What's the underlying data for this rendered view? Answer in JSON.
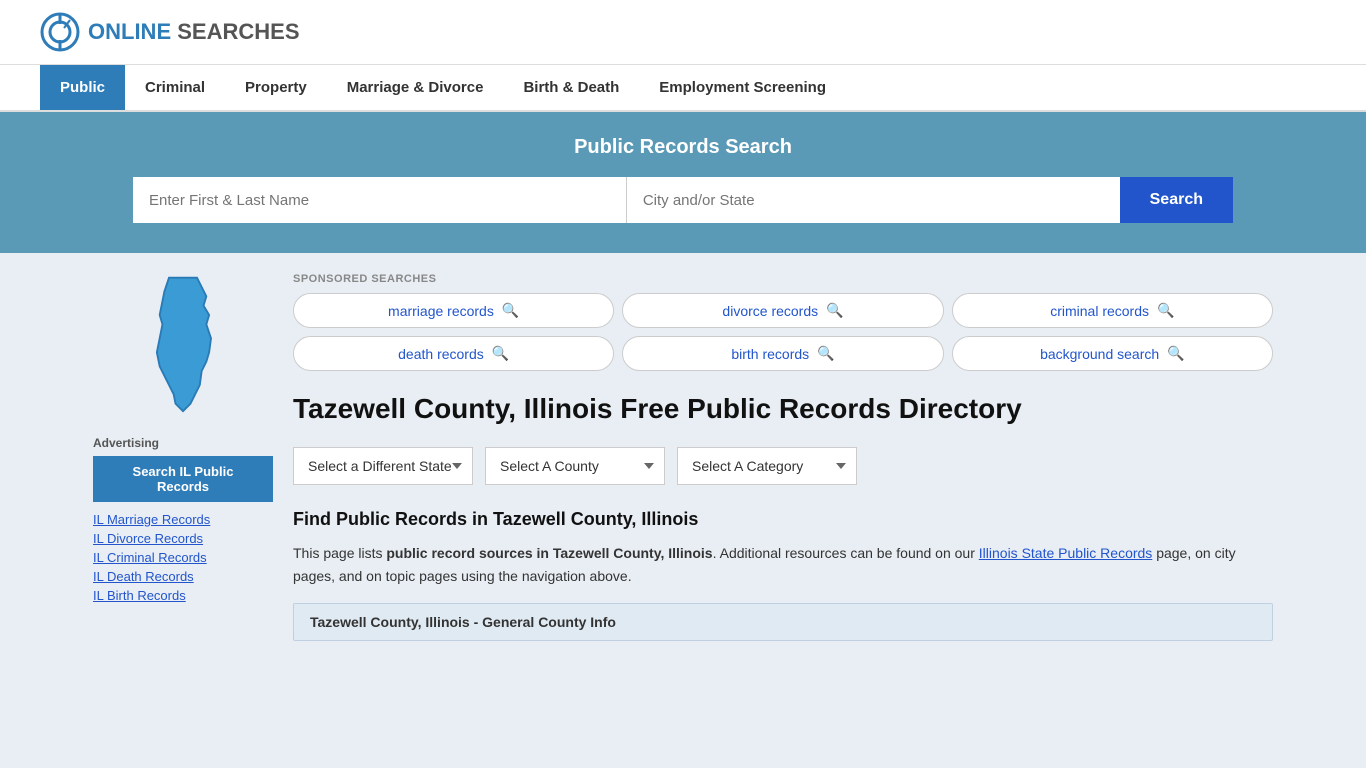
{
  "header": {
    "logo_text_normal": "ONLINE",
    "logo_text_bold": "SEARCHES"
  },
  "nav": {
    "items": [
      {
        "label": "Public",
        "active": true
      },
      {
        "label": "Criminal",
        "active": false
      },
      {
        "label": "Property",
        "active": false
      },
      {
        "label": "Marriage & Divorce",
        "active": false
      },
      {
        "label": "Birth & Death",
        "active": false
      },
      {
        "label": "Employment Screening",
        "active": false
      }
    ]
  },
  "search_banner": {
    "title": "Public Records Search",
    "name_placeholder": "Enter First & Last Name",
    "location_placeholder": "City and/or State",
    "button_label": "Search"
  },
  "sponsored": {
    "label": "SPONSORED SEARCHES",
    "items": [
      {
        "text": "marriage records"
      },
      {
        "text": "divorce records"
      },
      {
        "text": "criminal records"
      },
      {
        "text": "death records"
      },
      {
        "text": "birth records"
      },
      {
        "text": "background search"
      }
    ]
  },
  "page": {
    "title": "Tazewell County, Illinois Free Public Records Directory",
    "state_label": "Illinois",
    "dropdowns": {
      "state_label": "Select a Different State",
      "county_label": "Select A County",
      "category_label": "Select A Category"
    },
    "find_title": "Find Public Records in Tazewell County, Illinois",
    "find_desc_1": "This page lists ",
    "find_desc_bold": "public record sources in Tazewell County, Illinois",
    "find_desc_2": ". Additional resources can be found on our ",
    "find_link_text": "Illinois State Public Records",
    "find_desc_3": " page, on city pages, and on topic pages using the navigation above.",
    "county_bar": "Tazewell County, Illinois - General County Info"
  },
  "sidebar": {
    "advertising_label": "Advertising",
    "ad_button": "Search IL Public Records",
    "links": [
      {
        "text": "IL Marriage Records"
      },
      {
        "text": "IL Divorce Records"
      },
      {
        "text": "IL Criminal Records"
      },
      {
        "text": "IL Death Records"
      },
      {
        "text": "IL Birth Records"
      }
    ]
  }
}
